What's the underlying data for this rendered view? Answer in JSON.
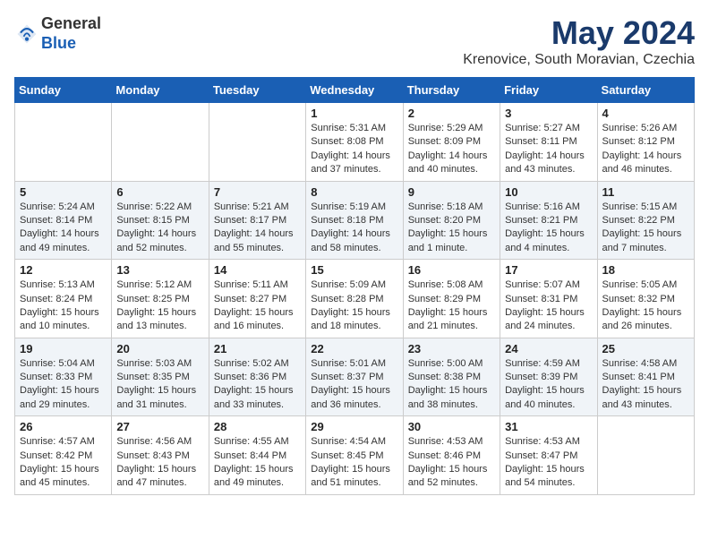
{
  "logo": {
    "general": "General",
    "blue": "Blue"
  },
  "header": {
    "month": "May 2024",
    "location": "Krenovice, South Moravian, Czechia"
  },
  "weekdays": [
    "Sunday",
    "Monday",
    "Tuesday",
    "Wednesday",
    "Thursday",
    "Friday",
    "Saturday"
  ],
  "weeks": [
    [
      {
        "day": "",
        "info": ""
      },
      {
        "day": "",
        "info": ""
      },
      {
        "day": "",
        "info": ""
      },
      {
        "day": "1",
        "info": "Sunrise: 5:31 AM\nSunset: 8:08 PM\nDaylight: 14 hours\nand 37 minutes."
      },
      {
        "day": "2",
        "info": "Sunrise: 5:29 AM\nSunset: 8:09 PM\nDaylight: 14 hours\nand 40 minutes."
      },
      {
        "day": "3",
        "info": "Sunrise: 5:27 AM\nSunset: 8:11 PM\nDaylight: 14 hours\nand 43 minutes."
      },
      {
        "day": "4",
        "info": "Sunrise: 5:26 AM\nSunset: 8:12 PM\nDaylight: 14 hours\nand 46 minutes."
      }
    ],
    [
      {
        "day": "5",
        "info": "Sunrise: 5:24 AM\nSunset: 8:14 PM\nDaylight: 14 hours\nand 49 minutes."
      },
      {
        "day": "6",
        "info": "Sunrise: 5:22 AM\nSunset: 8:15 PM\nDaylight: 14 hours\nand 52 minutes."
      },
      {
        "day": "7",
        "info": "Sunrise: 5:21 AM\nSunset: 8:17 PM\nDaylight: 14 hours\nand 55 minutes."
      },
      {
        "day": "8",
        "info": "Sunrise: 5:19 AM\nSunset: 8:18 PM\nDaylight: 14 hours\nand 58 minutes."
      },
      {
        "day": "9",
        "info": "Sunrise: 5:18 AM\nSunset: 8:20 PM\nDaylight: 15 hours\nand 1 minute."
      },
      {
        "day": "10",
        "info": "Sunrise: 5:16 AM\nSunset: 8:21 PM\nDaylight: 15 hours\nand 4 minutes."
      },
      {
        "day": "11",
        "info": "Sunrise: 5:15 AM\nSunset: 8:22 PM\nDaylight: 15 hours\nand 7 minutes."
      }
    ],
    [
      {
        "day": "12",
        "info": "Sunrise: 5:13 AM\nSunset: 8:24 PM\nDaylight: 15 hours\nand 10 minutes."
      },
      {
        "day": "13",
        "info": "Sunrise: 5:12 AM\nSunset: 8:25 PM\nDaylight: 15 hours\nand 13 minutes."
      },
      {
        "day": "14",
        "info": "Sunrise: 5:11 AM\nSunset: 8:27 PM\nDaylight: 15 hours\nand 16 minutes."
      },
      {
        "day": "15",
        "info": "Sunrise: 5:09 AM\nSunset: 8:28 PM\nDaylight: 15 hours\nand 18 minutes."
      },
      {
        "day": "16",
        "info": "Sunrise: 5:08 AM\nSunset: 8:29 PM\nDaylight: 15 hours\nand 21 minutes."
      },
      {
        "day": "17",
        "info": "Sunrise: 5:07 AM\nSunset: 8:31 PM\nDaylight: 15 hours\nand 24 minutes."
      },
      {
        "day": "18",
        "info": "Sunrise: 5:05 AM\nSunset: 8:32 PM\nDaylight: 15 hours\nand 26 minutes."
      }
    ],
    [
      {
        "day": "19",
        "info": "Sunrise: 5:04 AM\nSunset: 8:33 PM\nDaylight: 15 hours\nand 29 minutes."
      },
      {
        "day": "20",
        "info": "Sunrise: 5:03 AM\nSunset: 8:35 PM\nDaylight: 15 hours\nand 31 minutes."
      },
      {
        "day": "21",
        "info": "Sunrise: 5:02 AM\nSunset: 8:36 PM\nDaylight: 15 hours\nand 33 minutes."
      },
      {
        "day": "22",
        "info": "Sunrise: 5:01 AM\nSunset: 8:37 PM\nDaylight: 15 hours\nand 36 minutes."
      },
      {
        "day": "23",
        "info": "Sunrise: 5:00 AM\nSunset: 8:38 PM\nDaylight: 15 hours\nand 38 minutes."
      },
      {
        "day": "24",
        "info": "Sunrise: 4:59 AM\nSunset: 8:39 PM\nDaylight: 15 hours\nand 40 minutes."
      },
      {
        "day": "25",
        "info": "Sunrise: 4:58 AM\nSunset: 8:41 PM\nDaylight: 15 hours\nand 43 minutes."
      }
    ],
    [
      {
        "day": "26",
        "info": "Sunrise: 4:57 AM\nSunset: 8:42 PM\nDaylight: 15 hours\nand 45 minutes."
      },
      {
        "day": "27",
        "info": "Sunrise: 4:56 AM\nSunset: 8:43 PM\nDaylight: 15 hours\nand 47 minutes."
      },
      {
        "day": "28",
        "info": "Sunrise: 4:55 AM\nSunset: 8:44 PM\nDaylight: 15 hours\nand 49 minutes."
      },
      {
        "day": "29",
        "info": "Sunrise: 4:54 AM\nSunset: 8:45 PM\nDaylight: 15 hours\nand 51 minutes."
      },
      {
        "day": "30",
        "info": "Sunrise: 4:53 AM\nSunset: 8:46 PM\nDaylight: 15 hours\nand 52 minutes."
      },
      {
        "day": "31",
        "info": "Sunrise: 4:53 AM\nSunset: 8:47 PM\nDaylight: 15 hours\nand 54 minutes."
      },
      {
        "day": "",
        "info": ""
      }
    ]
  ]
}
